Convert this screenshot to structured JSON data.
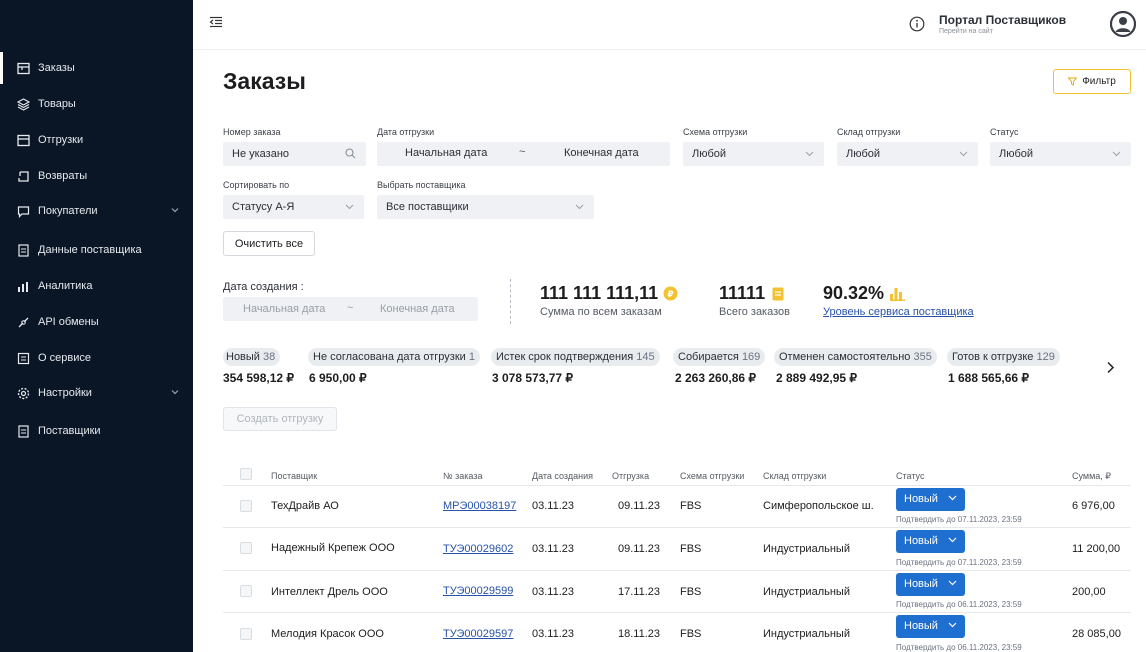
{
  "sidebar": {
    "items": [
      {
        "label": "Заказы",
        "icon": "orders-icon"
      },
      {
        "label": "Товары",
        "icon": "products-icon"
      },
      {
        "label": "Отгрузки",
        "icon": "shipments-icon"
      },
      {
        "label": "Возвраты",
        "icon": "returns-icon"
      },
      {
        "label": "Покупатели",
        "icon": "buyers-icon"
      },
      {
        "label": "Данные поставщика",
        "icon": "supplier-data-icon"
      },
      {
        "label": "Аналитика",
        "icon": "analytics-icon"
      },
      {
        "label": "API обмены",
        "icon": "api-icon"
      },
      {
        "label": "О сервисе",
        "icon": "about-icon"
      },
      {
        "label": "Настройки",
        "icon": "settings-icon"
      },
      {
        "label": "Поставщики",
        "icon": "suppliers-icon"
      }
    ]
  },
  "header": {
    "portal_title": "Портал Поставщиков",
    "portal_subtitle": "Перейти на сайт"
  },
  "page": {
    "title": "Заказы",
    "filter_button": "Фильтр"
  },
  "filters": {
    "order_number_label": "Номер заказа",
    "order_number_value": "Не указано",
    "ship_date_label": "Дата отгрузки",
    "ship_date_start": "Начальная дата",
    "ship_date_sep": "~",
    "ship_date_end": "Конечная дата",
    "scheme_label": "Схема отгрузки",
    "scheme_value": "Любой",
    "warehouse_label": "Склад отгрузки",
    "warehouse_value": "Любой",
    "status_label": "Статус",
    "status_value": "Любой",
    "sort_label": "Сортировать по",
    "sort_value": "Статусу А-Я",
    "supplier_label": "Выбрать поставщика",
    "supplier_value": "Все поставщики",
    "clear_button": "Очистить все",
    "created_label": "Дата создания :",
    "created_start": "Начальная дата",
    "created_sep": "~",
    "created_end": "Конечная дата"
  },
  "summary": {
    "total_sum": "111 111 111,11",
    "total_sum_caption": "Сумма по всем заказам",
    "total_orders": "11111",
    "total_orders_caption": "Всего заказов",
    "service_level": "90.32%",
    "service_level_caption": "Уровень сервиса поставщика"
  },
  "status_chips": [
    {
      "label": "Новый",
      "count": "38",
      "amount": "354 598,12 ₽"
    },
    {
      "label": "Не согласована дата отгрузки",
      "count": "1",
      "amount": "6 950,00 ₽"
    },
    {
      "label": "Истек срок подтверждения",
      "count": "145",
      "amount": "3 078 573,77 ₽"
    },
    {
      "label": "Собирается",
      "count": "169",
      "amount": "2 263 260,86 ₽"
    },
    {
      "label": "Отменен самостоятельно",
      "count": "355",
      "amount": "2 889 492,95 ₽"
    },
    {
      "label": "Готов к отгрузке",
      "count": "129",
      "amount": "1 688 565,66 ₽"
    }
  ],
  "create_shipment_button": "Создать отгрузку",
  "table": {
    "headers": [
      "Поставщик",
      "№ заказа",
      "Дата создания",
      "Отгрузка",
      "Схема отгрузки",
      "Склад отгрузки",
      "Статус",
      "Сумма, ₽"
    ],
    "rows": [
      {
        "supplier": "ТехДрайв АО",
        "order": "МРЭ00038197",
        "created": "03.11.23",
        "ship": "09.11.23",
        "scheme": "FBS",
        "warehouse": "Симферопольское ш.",
        "status": "Новый",
        "confirm": "Подтвердить до 07.11.2023, 23:59",
        "sum": "6 976,00"
      },
      {
        "supplier": "Надежный Крепеж ООО",
        "order": "ТУЭ00029602",
        "created": "03.11.23",
        "ship": "09.11.23",
        "scheme": "FBS",
        "warehouse": "Индустриальный",
        "status": "Новый",
        "confirm": "Подтвердить до 07.11.2023, 23:59",
        "sum": "11 200,00"
      },
      {
        "supplier": "Интеллект Дрель ООО",
        "order": "ТУЭ00029599",
        "created": "03.11.23",
        "ship": "17.11.23",
        "scheme": "FBS",
        "warehouse": "Индустриальный",
        "status": "Новый",
        "confirm": "Подтвердить до 06.11.2023, 23:59",
        "sum": "200,00"
      },
      {
        "supplier": "Мелодия Красок ООО",
        "order": "ТУЭ00029597",
        "created": "03.11.23",
        "ship": "18.11.23",
        "scheme": "FBS",
        "warehouse": "Индустриальный",
        "status": "Новый",
        "confirm": "Подтвердить до 06.11.2023, 23:59",
        "sum": "28 085,00"
      }
    ]
  },
  "colors": {
    "sidebar_bg": "#0a1626",
    "accent_blue": "#1f6fd1",
    "coin_yellow": "#f2c230"
  }
}
